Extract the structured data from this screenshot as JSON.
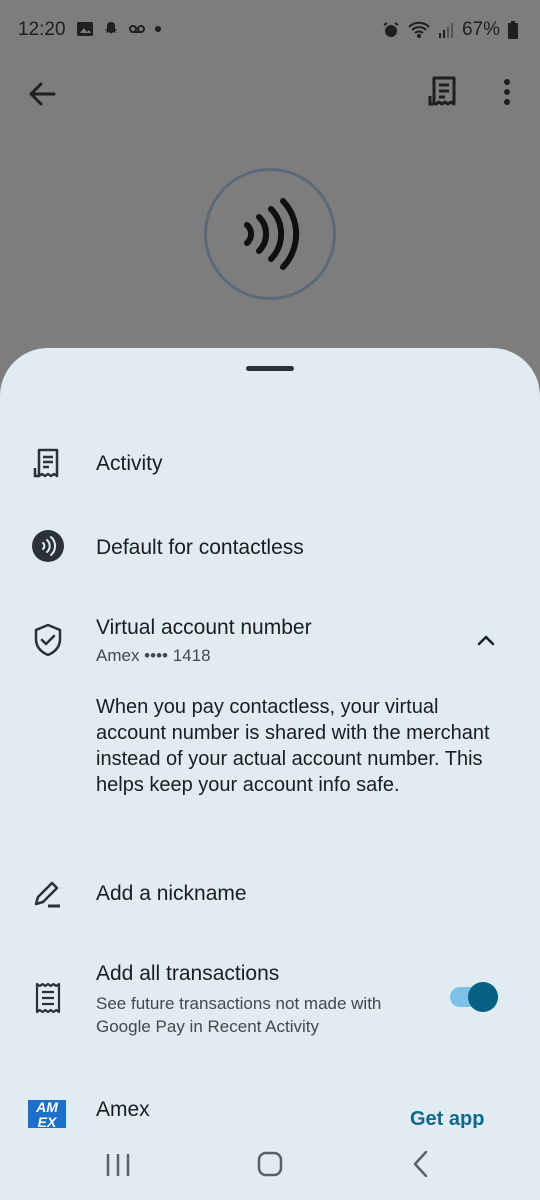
{
  "status": {
    "time": "12:20",
    "battery": "67%"
  },
  "sheet": {
    "activity": {
      "label": "Activity"
    },
    "contactless": {
      "label": "Default for contactless"
    },
    "virtual": {
      "title": "Virtual account number",
      "subtitle": "Amex •••• 1418",
      "description": "When you pay contactless, your virtual account number is shared with the merchant instead of your actual account number. This helps keep your account info safe."
    },
    "nickname": {
      "label": "Add a nickname"
    },
    "transactions": {
      "title": "Add all transactions",
      "subtitle": "See future transactions not made with Google Pay in Recent Activity",
      "enabled": true
    },
    "amex": {
      "title": "Amex",
      "logo_text": "AM EX",
      "action": "Get app"
    }
  },
  "colors": {
    "sheet_bg": "#e0ebf2",
    "accent": "#056081",
    "link": "#0e6a8a",
    "scrim": "#7d7d7d"
  }
}
